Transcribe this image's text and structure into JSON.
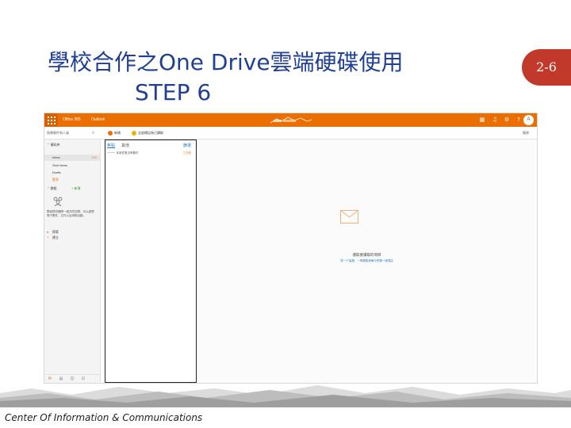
{
  "slide": {
    "title": "學校合作之One Drive雲端硬碟使用",
    "subtitle": "STEP 6",
    "page_badge": "2-6",
    "footer": "Center Of Information & Communications",
    "accent_color": "#1f3f94",
    "badge_color": "#c0392b"
  },
  "screenshot": {
    "topbar": {
      "app_name": "Office 365",
      "product": "Outlook",
      "bar_color": "#eb6e00",
      "icons": [
        "grid-icon",
        "bell-icon",
        "gear-icon",
        "help-icon"
      ],
      "avatar_initial": "A"
    },
    "cmdbar": {
      "search_placeholder": "搜尋郵件和人員",
      "new_label": "新增",
      "mark_read_label": "全部標記為已讀取",
      "undo_label": "復原"
    },
    "nav": {
      "folders_header": "資料夾",
      "items": [
        {
          "label": "Inbox",
          "count": "212"
        },
        {
          "label": "Sent Items",
          "count": ""
        },
        {
          "label": "Drafts",
          "count": ""
        },
        {
          "label": "更多",
          "count": ""
        }
      ],
      "groups_header": "群組",
      "new_group": "+ 新增",
      "groups_desc": "群組提供團隊一個共同空間，可以處理電子郵件、文件以及排程活動。",
      "links": [
        "探索",
        "建立"
      ]
    },
    "list": {
      "tab_focused": "焦點",
      "tab_other": "其他",
      "filter_label": "篩選",
      "row_text": "一一一 本收件匣沒有郵件",
      "row_side": "三日前"
    },
    "reading": {
      "empty_title": "選取要讀取的項目",
      "empty_hint": "按一下這裡，一律選取清單中的第一個項目"
    }
  }
}
